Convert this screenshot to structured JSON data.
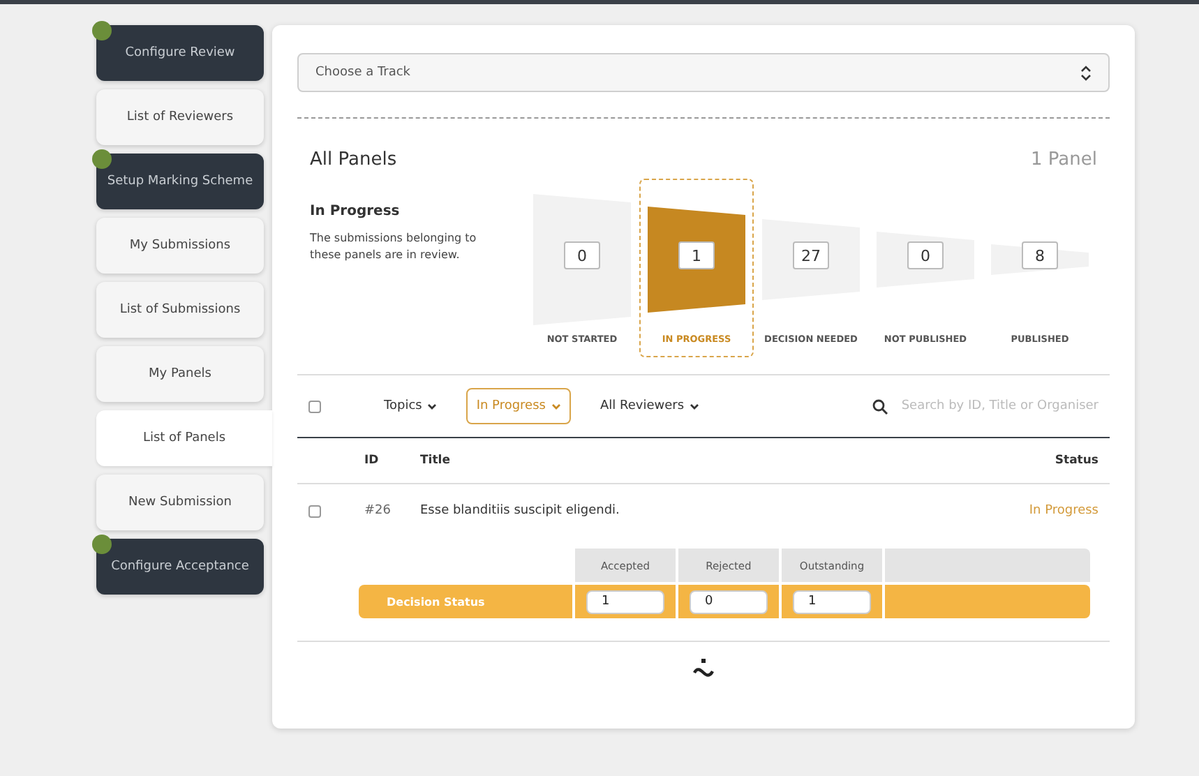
{
  "sidebar": {
    "items": [
      {
        "label": "Configure Review",
        "kind": "section",
        "selected": false
      },
      {
        "label": "List of Reviewers",
        "kind": "link",
        "selected": false
      },
      {
        "label": "Setup Marking Scheme",
        "kind": "section",
        "selected": false
      },
      {
        "label": "My Submissions",
        "kind": "link",
        "selected": false
      },
      {
        "label": "List of Submissions",
        "kind": "link",
        "selected": false
      },
      {
        "label": "My Panels",
        "kind": "link",
        "selected": false
      },
      {
        "label": "List of Panels",
        "kind": "link",
        "selected": true
      },
      {
        "label": "New Submission",
        "kind": "link",
        "selected": false
      },
      {
        "label": "Configure Acceptance",
        "kind": "section",
        "selected": false
      }
    ]
  },
  "track_select": {
    "placeholder": "Choose a Track"
  },
  "header": {
    "title": "All Panels",
    "count": "1 Panel"
  },
  "stage_info": {
    "title": "In Progress",
    "description": "The submissions belonging to these panels are in review."
  },
  "funnel": [
    {
      "label": "NOT STARTED",
      "count": "0",
      "selected": false
    },
    {
      "label": "IN PROGRESS",
      "count": "1",
      "selected": true
    },
    {
      "label": "DECISION NEEDED",
      "count": "27",
      "selected": false
    },
    {
      "label": "NOT PUBLISHED",
      "count": "0",
      "selected": false
    },
    {
      "label": "PUBLISHED",
      "count": "8",
      "selected": false
    }
  ],
  "filters": {
    "checked": false,
    "items": [
      {
        "label": "Topics",
        "selected": false
      },
      {
        "label": "In Progress",
        "selected": true
      },
      {
        "label": "All Reviewers",
        "selected": false
      }
    ],
    "search_placeholder": "Search by ID, Title or Organiser"
  },
  "table": {
    "columns": [
      "ID",
      "Title",
      "Status"
    ],
    "rows": [
      {
        "checked": false,
        "id": "#26",
        "title": "Esse blanditiis suscipit eligendi.",
        "status": "In Progress"
      }
    ]
  },
  "decision": {
    "columns": [
      "Accepted",
      "Rejected",
      "Outstanding"
    ],
    "label": "Decision Status",
    "values": [
      "1",
      "0",
      "1"
    ]
  }
}
